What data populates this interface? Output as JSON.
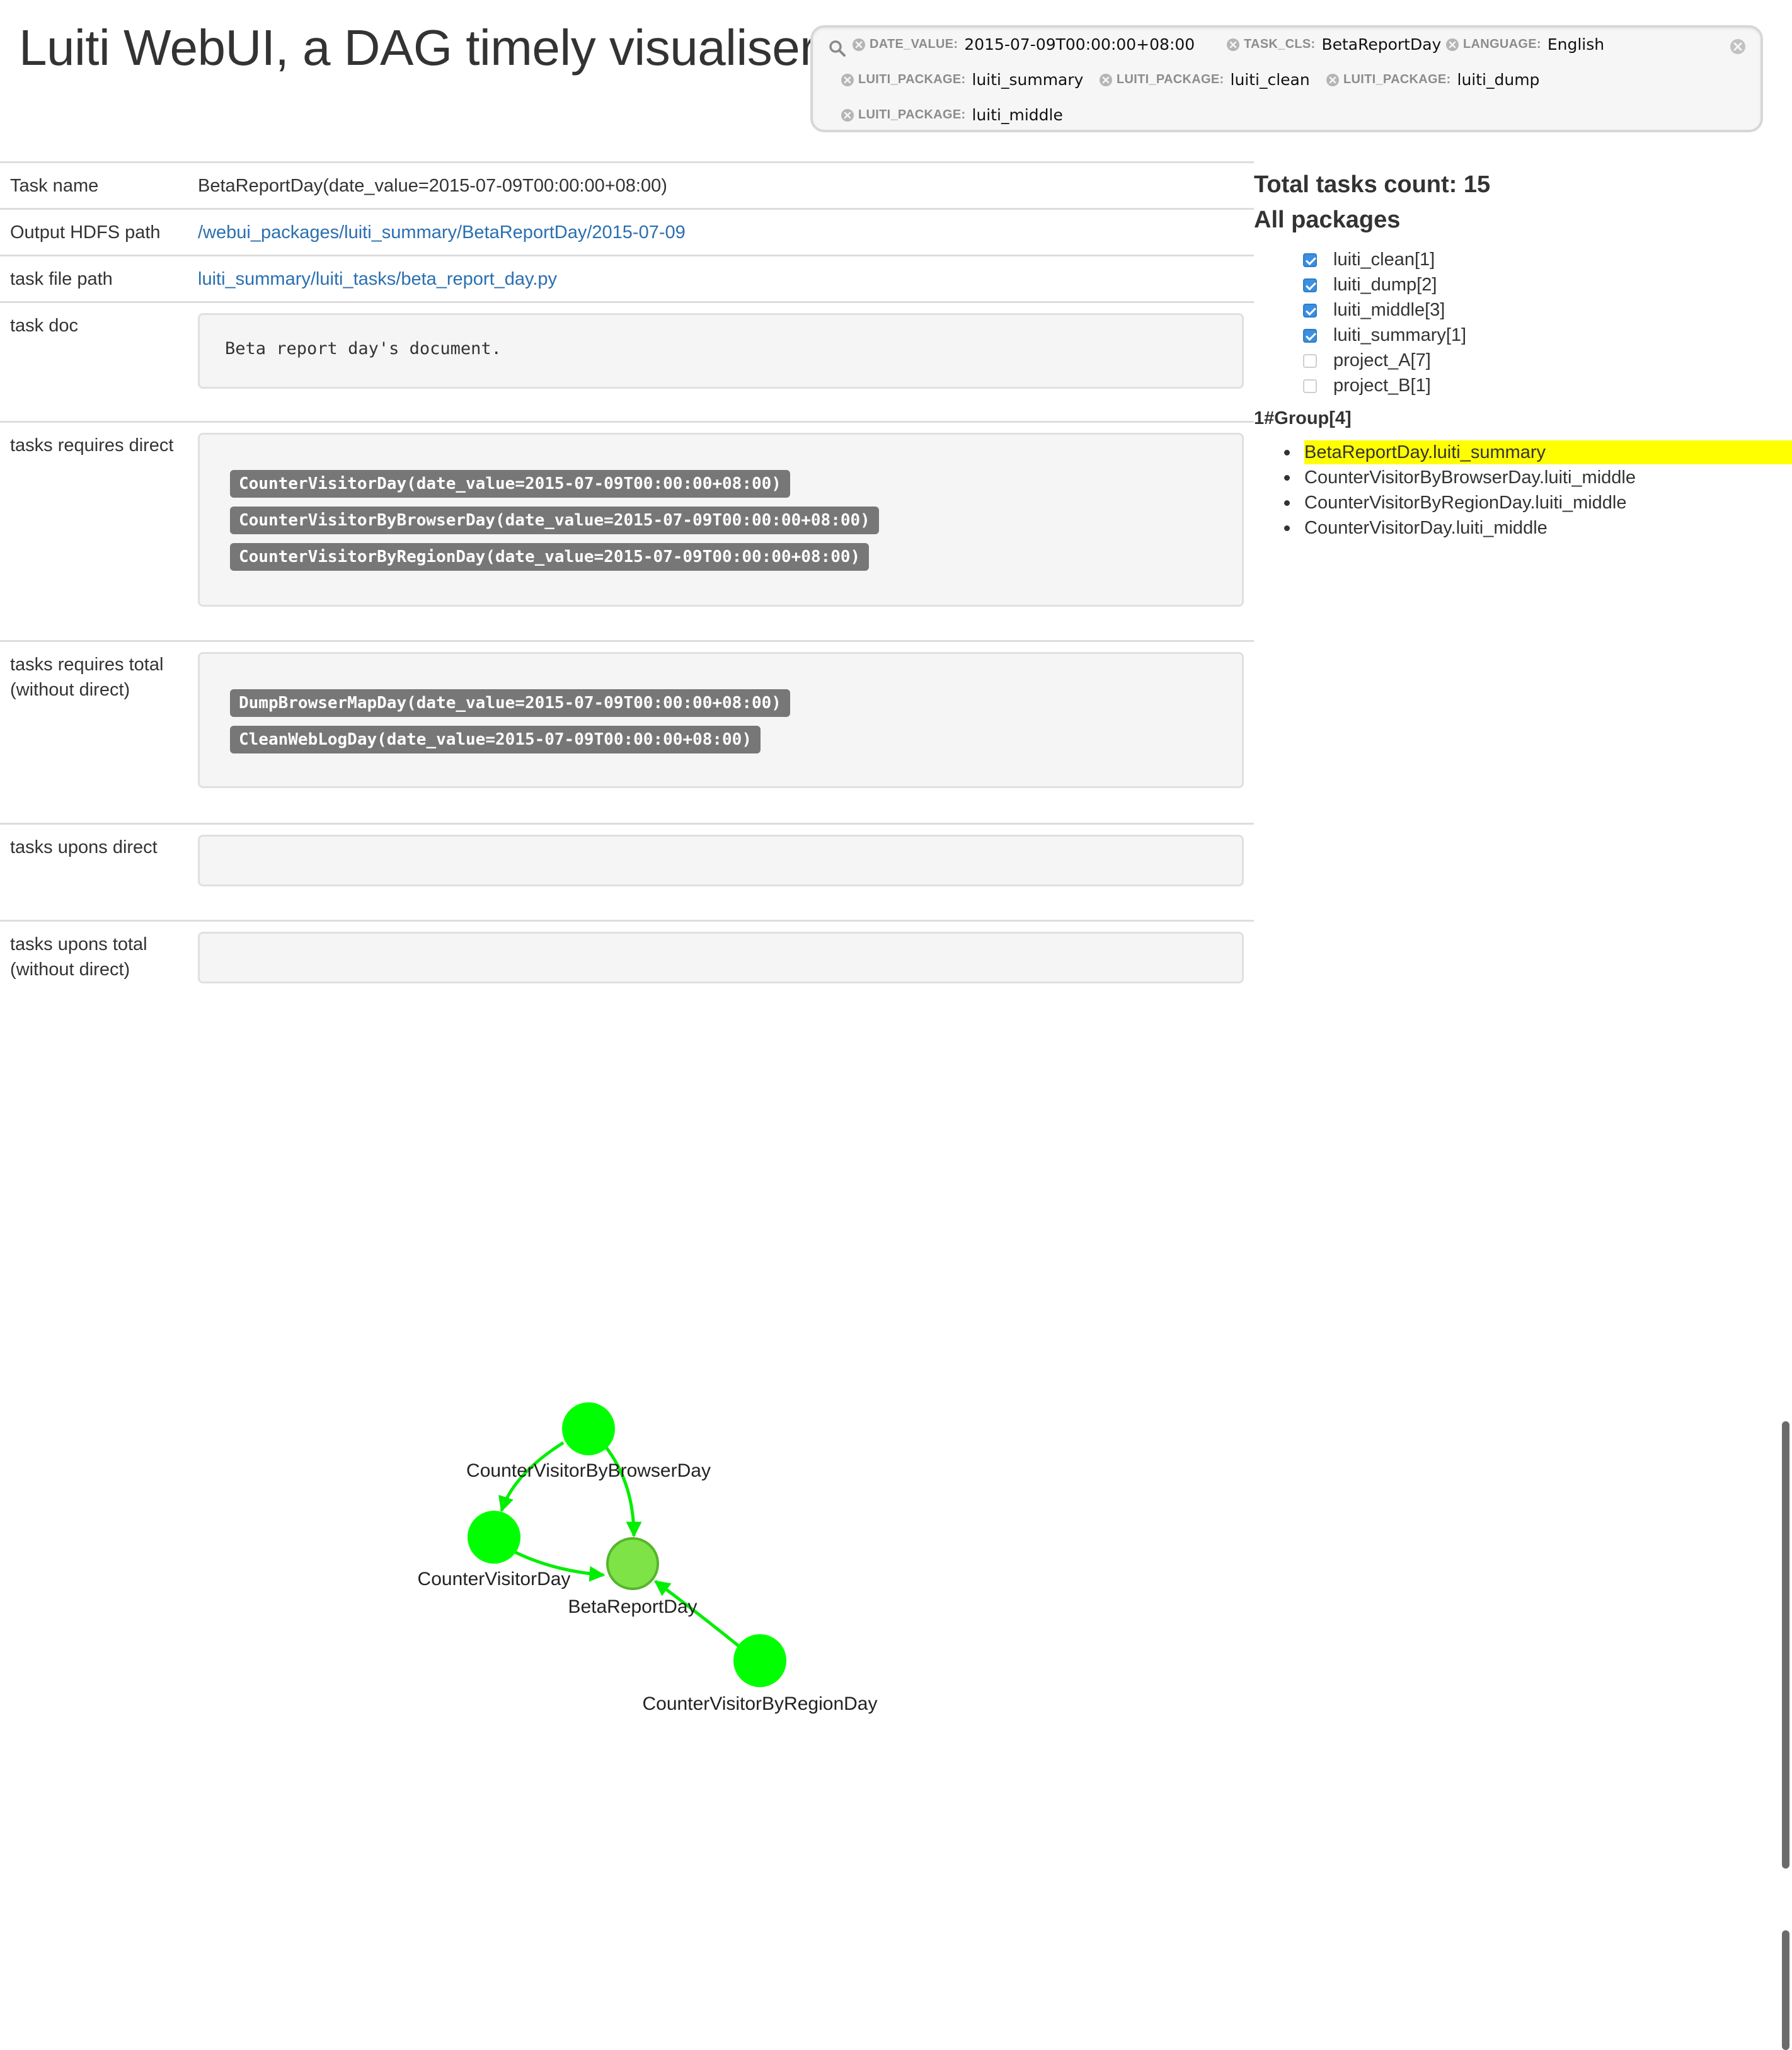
{
  "header": {
    "title": "Luiti WebUI, a DAG timely visualiser."
  },
  "search": {
    "facets": [
      {
        "key": "DATE_VALUE:",
        "value": "2015-07-09T00:00:00+08:00"
      },
      {
        "key": "TASK_CLS:",
        "value": "BetaReportDay"
      },
      {
        "key": "LANGUAGE:",
        "value": "English"
      },
      {
        "key": "LUITI_PACKAGE:",
        "value": "luiti_summary"
      },
      {
        "key": "LUITI_PACKAGE:",
        "value": "luiti_clean"
      },
      {
        "key": "LUITI_PACKAGE:",
        "value": "luiti_dump"
      },
      {
        "key": "LUITI_PACKAGE:",
        "value": "luiti_middle"
      }
    ]
  },
  "details": {
    "task_name": {
      "label": "Task name",
      "value": "BetaReportDay(date_value=2015-07-09T00:00:00+08:00)"
    },
    "output_path": {
      "label": "Output HDFS path",
      "value": "/webui_packages/luiti_summary/BetaReportDay/2015-07-09"
    },
    "file_path": {
      "label": "task file path",
      "value": "luiti_summary/luiti_tasks/beta_report_day.py"
    },
    "task_doc": {
      "label": "task doc",
      "value": "Beta report day's document."
    },
    "requires_direct": {
      "label": "tasks requires direct",
      "tasks": [
        "CounterVisitorDay(date_value=2015-07-09T00:00:00+08:00)",
        "CounterVisitorByBrowserDay(date_value=2015-07-09T00:00:00+08:00)",
        "CounterVisitorByRegionDay(date_value=2015-07-09T00:00:00+08:00)"
      ]
    },
    "requires_total": {
      "label_line1": "tasks requires total",
      "label_line2": "(without direct)",
      "tasks": [
        "DumpBrowserMapDay(date_value=2015-07-09T00:00:00+08:00)",
        "CleanWebLogDay(date_value=2015-07-09T00:00:00+08:00)"
      ]
    },
    "upons_direct": {
      "label": "tasks upons direct"
    },
    "upons_total": {
      "label_line1": "tasks upons total",
      "label_line2": "(without direct)"
    }
  },
  "sidebar": {
    "total_count": "Total tasks count: 15",
    "packages_title": "All packages",
    "packages": [
      {
        "label": "luiti_clean[1]",
        "checked": true
      },
      {
        "label": "luiti_dump[2]",
        "checked": true
      },
      {
        "label": "luiti_middle[3]",
        "checked": true
      },
      {
        "label": "luiti_summary[1]",
        "checked": true
      },
      {
        "label": "project_A[7]",
        "checked": false
      },
      {
        "label": "project_B[1]",
        "checked": false
      }
    ],
    "group_title": "1#Group[4]",
    "group_items": [
      {
        "label": "BetaReportDay.luiti_summary",
        "highlighted": true
      },
      {
        "label": "CounterVisitorByBrowserDay.luiti_middle",
        "highlighted": false
      },
      {
        "label": "CounterVisitorByRegionDay.luiti_middle",
        "highlighted": false
      },
      {
        "label": "CounterVisitorDay.luiti_middle",
        "highlighted": false
      }
    ]
  },
  "graph": {
    "nodes": [
      {
        "id": "browser",
        "label": "CounterVisitorByBrowserDay",
        "color": "#00ff00"
      },
      {
        "id": "visitor",
        "label": "CounterVisitorDay",
        "color": "#00ff00"
      },
      {
        "id": "beta",
        "label": "BetaReportDay",
        "color": "#7ee346",
        "stroke": "#55b52a"
      },
      {
        "id": "region",
        "label": "CounterVisitorByRegionDay",
        "color": "#00ff00"
      }
    ],
    "edges": [
      {
        "from": "browser",
        "to": "visitor"
      },
      {
        "from": "browser",
        "to": "beta"
      },
      {
        "from": "visitor",
        "to": "beta"
      },
      {
        "from": "region",
        "to": "beta"
      }
    ],
    "edge_color": "#00ee00"
  },
  "icons": {
    "search": "search-icon",
    "remove": "remove-circle-icon",
    "clear": "clear-all-icon"
  }
}
